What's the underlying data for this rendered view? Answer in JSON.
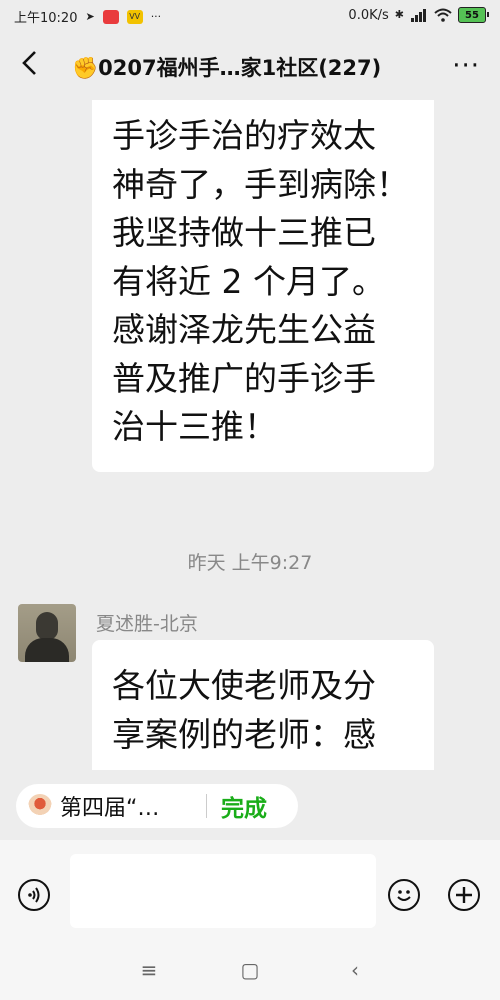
{
  "status_bar": {
    "time": "上午10:20",
    "net_speed": "0.0K/s",
    "battery": "55",
    "app_badge_1": "小红书",
    "app_badge_2": "VV"
  },
  "header": {
    "back_icon": "‹",
    "title": "✊0207福州手…家1社区(227)",
    "more_icon": "···"
  },
  "messages": {
    "bubble1_lines": [
      "手诊手治的疗效太",
      "神奇了，手到病除！",
      "我坚持做十三推已",
      "有将近 2 个月了。",
      "感谢泽龙先生公益",
      "普及推广的手诊手",
      "治十三推！"
    ],
    "timestamp": "昨天 上午9:27",
    "sender_name": "夏述胜-北京",
    "bubble2_lines": [
      "各位大使老师及分",
      "享案例的老师：感"
    ]
  },
  "quick_reply": {
    "quote_text": "第四届“…",
    "done_label": "完成"
  },
  "input": {
    "voice_icon": "voice-icon",
    "emoji_icon": "emoji-icon",
    "plus_icon": "plus-icon"
  },
  "nav": {
    "menu_glyph": "≡",
    "home_glyph": "▢",
    "back_glyph": "‹"
  },
  "colors": {
    "background": "#ededed",
    "accent_green": "#1aad19",
    "battery_green": "#55c255"
  }
}
